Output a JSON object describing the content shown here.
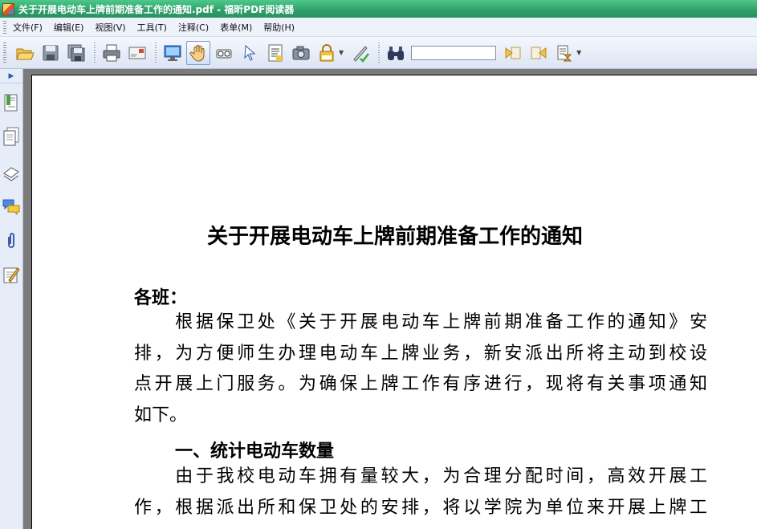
{
  "window": {
    "title": "关于开展电动车上牌前期准备工作的通知.pdf - 福昕PDF阅读器"
  },
  "menu": [
    {
      "label": "文件(F)"
    },
    {
      "label": "编辑(E)"
    },
    {
      "label": "视图(V)"
    },
    {
      "label": "工具(T)"
    },
    {
      "label": "注释(C)"
    },
    {
      "label": "表单(M)"
    },
    {
      "label": "帮助(H)"
    }
  ],
  "toolbar": {
    "find_value": "",
    "active_tool": "hand-tool",
    "icons": [
      "open-icon",
      "save-icon",
      "save-all-icon",
      "print-icon",
      "email-icon",
      "fullscreen-icon",
      "hand-icon",
      "loupe-icon",
      "select-icon",
      "text-select-icon",
      "snapshot-icon",
      "rms-lock-icon",
      "sign-icon",
      "find-icon",
      "find-prev-icon",
      "find-next-icon",
      "find-options-icon"
    ]
  },
  "left_panel": {
    "icons": [
      "bookmarks-icon",
      "pages-icon",
      "layers-icon",
      "comments-icon",
      "attachments-icon",
      "signatures-icon"
    ]
  },
  "document": {
    "title": "关于开展电动车上牌前期准备工作的通知",
    "salutation": "各班：",
    "paragraph1_lines": [
      "　　根据保卫处《关于开展电动车上牌前期准备工作的通知》安",
      "排，为方便师生办理电动车上牌业务，新安派出所将主动到校设",
      "点开展上门服务。为确保上牌工作有序进行，现将有关事项通知",
      "如下。"
    ],
    "section1_heading": "一、统计电动车数量",
    "paragraph2_lines": [
      "　　由于我校电动车拥有量较大，为合理分配时间，高效开展工",
      "作，根据派出所和保卫处的安排，将以学院为单位来开展上牌工"
    ]
  },
  "colors": {
    "titlebar": "#2f9e69",
    "menubar": "#eef2fa",
    "toolbar": "#dde5f3",
    "doc_background": "#7b7b7b"
  }
}
